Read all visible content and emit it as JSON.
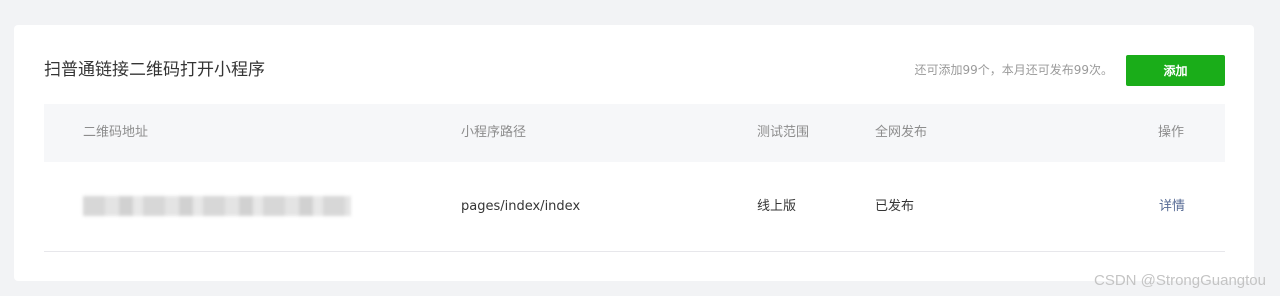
{
  "header": {
    "title": "扫普通链接二维码打开小程序",
    "quota_text": "还可添加99个，本月还可发布99次。",
    "add_label": "添加"
  },
  "table": {
    "columns": [
      "二维码地址",
      "小程序路径",
      "测试范围",
      "全网发布",
      "操作"
    ],
    "rows": [
      {
        "qr_url": "",
        "path": "pages/index/index",
        "test_scope": "线上版",
        "publish_status": "已发布",
        "action": "详情"
      }
    ]
  },
  "watermark": "CSDN @StrongGuangtou",
  "colors": {
    "accent": "#1aad19",
    "link": "#576b95",
    "background": "#f2f3f5"
  }
}
